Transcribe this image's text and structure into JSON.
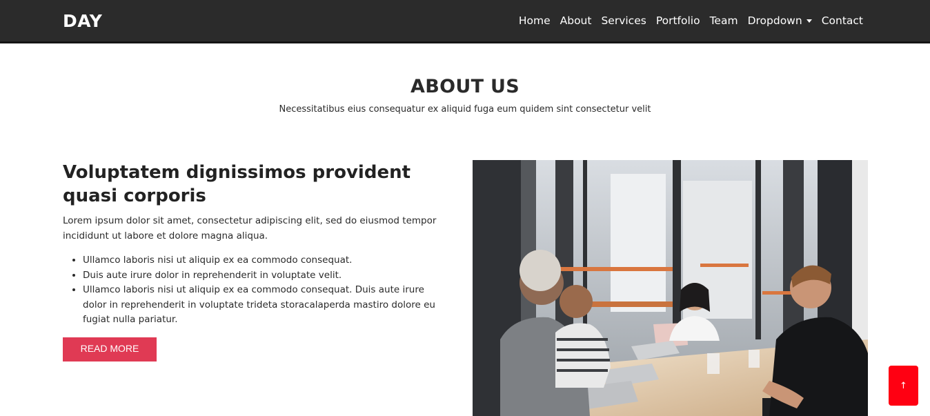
{
  "header": {
    "brand": "DAY",
    "nav": [
      {
        "label": "Home"
      },
      {
        "label": "About"
      },
      {
        "label": "Services"
      },
      {
        "label": "Portfolio"
      },
      {
        "label": "Team"
      },
      {
        "label": "Dropdown",
        "has_caret": true
      },
      {
        "label": "Contact"
      }
    ]
  },
  "about": {
    "title": "ABOUT US",
    "subtitle": "Necessitatibus eius consequatur ex aliquid fuga eum quidem sint consectetur velit",
    "heading": "Voluptatem dignissimos provident quasi corporis",
    "lead": "Lorem ipsum dolor sit amet, consectetur adipiscing elit, sed do eiusmod tempor incididunt ut labore et dolore magna aliqua.",
    "bullets": [
      "Ullamco laboris nisi ut aliquip ex ea commodo consequat.",
      "Duis aute irure dolor in reprehenderit in voluptate velit.",
      "Ullamco laboris nisi ut aliquip ex ea commodo consequat. Duis aute irure dolor in reprehenderit in voluptate trideta storacalaperda mastiro dolore eu fugiat nulla pariatur."
    ],
    "button_label": "READ MORE"
  },
  "back_to_top": {
    "icon": "arrow-up-icon",
    "glyph": "↑"
  },
  "colors": {
    "accent": "#e03a54",
    "back_to_top": "#ff0012",
    "navbar": "#2b2b2b"
  }
}
